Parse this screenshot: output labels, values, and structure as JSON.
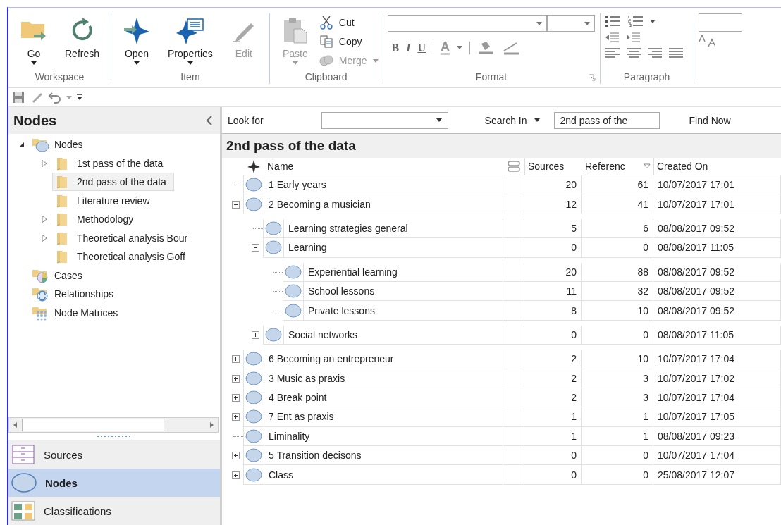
{
  "ribbon": {
    "groups": [
      {
        "label": "Workspace",
        "kind": "large",
        "buttons": [
          {
            "label": "Go",
            "kind": "folder-go",
            "dropdown": true,
            "disabled": false
          },
          {
            "label": "Refresh",
            "kind": "refresh",
            "dropdown": false,
            "disabled": false
          }
        ]
      },
      {
        "label": "Item",
        "kind": "large",
        "buttons": [
          {
            "label": "Open",
            "kind": "open",
            "dropdown": true,
            "disabled": false
          },
          {
            "label": "Properties",
            "kind": "properties",
            "dropdown": true,
            "disabled": false
          },
          {
            "label": "Edit",
            "kind": "edit",
            "dropdown": false,
            "disabled": true
          }
        ]
      },
      {
        "label": "Clipboard",
        "kind": "clipboard",
        "buttons": [
          {
            "label": "Paste",
            "kind": "paste",
            "dropdown": true,
            "disabled": true
          }
        ],
        "small_buttons": [
          {
            "label": "Cut",
            "kind": "cut",
            "dropdown": false,
            "disabled": false
          },
          {
            "label": "Copy",
            "kind": "copy",
            "dropdown": false,
            "disabled": false
          },
          {
            "label": "Merge",
            "kind": "merge",
            "dropdown": true,
            "disabled": true
          }
        ]
      },
      {
        "label": "Format",
        "kind": "format",
        "styles": [
          "B",
          "I",
          "U"
        ],
        "color_letter": "A"
      },
      {
        "label": "Paragraph",
        "kind": "paragraph"
      },
      {
        "kind": "partial"
      }
    ]
  },
  "navigator": {
    "title": "Nodes",
    "tree": [
      {
        "label": "Nodes",
        "kind": "nodes",
        "expanded": true,
        "selected": false,
        "children": [
          {
            "label": "1st pass of the data",
            "kind": "folder",
            "expanded": false,
            "selected": false
          },
          {
            "label": "2nd pass of the data",
            "kind": "folder",
            "selected": true
          },
          {
            "label": "Literature review",
            "kind": "folder",
            "selected": false
          },
          {
            "label": "Methodology",
            "kind": "folder",
            "expanded": false,
            "selected": false
          },
          {
            "label": "Theoretical analysis Bour",
            "kind": "folder",
            "expanded": false,
            "selected": false
          },
          {
            "label": "Theoretical analysis Goff",
            "kind": "folder",
            "selected": false
          }
        ]
      },
      {
        "label": "Cases",
        "kind": "cases",
        "selected": false
      },
      {
        "label": "Relationships",
        "kind": "relationships",
        "selected": false
      },
      {
        "label": "Node Matrices",
        "kind": "matrices",
        "selected": false
      }
    ],
    "nav_buttons": [
      {
        "label": "Sources",
        "kind": "sources",
        "selected": false
      },
      {
        "label": "Nodes",
        "kind": "nodes",
        "selected": true
      },
      {
        "label": "Classifications",
        "kind": "classifications",
        "selected": false
      }
    ]
  },
  "search": {
    "look_for_label": "Look for",
    "search_in_label": "Search In",
    "search_in_value": "2nd pass of the",
    "find_button": "Find Now"
  },
  "list": {
    "title": "2nd pass of the data",
    "columns": [
      "Name",
      "Sources",
      "Referenc",
      "Created On"
    ],
    "rows": [
      {
        "name": "1 Early years",
        "sources": "20",
        "references": "61",
        "created": "10/07/2017 17:01"
      },
      {
        "name": "2 Becoming a musician",
        "sources": "12",
        "references": "41",
        "created": "10/07/2017 17:01",
        "expanded": true,
        "children": [
          {
            "name": "Learning strategies general",
            "sources": "5",
            "references": "6",
            "created": "08/08/2017 09:52"
          },
          {
            "name": "Learning",
            "sources": "0",
            "references": "0",
            "created": "08/08/2017 11:05",
            "expanded": true,
            "children": [
              {
                "name": "Experiential learning",
                "sources": "20",
                "references": "88",
                "created": "08/08/2017 09:52"
              },
              {
                "name": "School lessons",
                "sources": "11",
                "references": "32",
                "created": "08/08/2017 09:52"
              },
              {
                "name": "Private lessons",
                "sources": "8",
                "references": "10",
                "created": "08/08/2017 09:52"
              }
            ]
          },
          {
            "name": "Social networks",
            "sources": "0",
            "references": "0",
            "created": "08/08/2017 11:05",
            "expanded": false
          }
        ]
      },
      {
        "name": "6 Becoming an entrepreneur",
        "sources": "2",
        "references": "10",
        "created": "10/07/2017 17:04",
        "expanded": false
      },
      {
        "name": "3 Music as praxis",
        "sources": "2",
        "references": "3",
        "created": "10/07/2017 17:02",
        "expanded": false
      },
      {
        "name": "4 Break point",
        "sources": "2",
        "references": "3",
        "created": "10/07/2017 17:04",
        "expanded": false
      },
      {
        "name": "7 Ent as praxis",
        "sources": "1",
        "references": "1",
        "created": "10/07/2017 17:05",
        "expanded": false
      },
      {
        "name": "Liminality",
        "sources": "1",
        "references": "1",
        "created": "08/08/2017 09:23"
      },
      {
        "name": "5 Transition decisons",
        "sources": "0",
        "references": "0",
        "created": "10/07/2017 17:04",
        "expanded": false
      },
      {
        "name": "Class",
        "sources": "0",
        "references": "0",
        "created": "25/08/2017 12:07",
        "expanded": false
      }
    ]
  }
}
